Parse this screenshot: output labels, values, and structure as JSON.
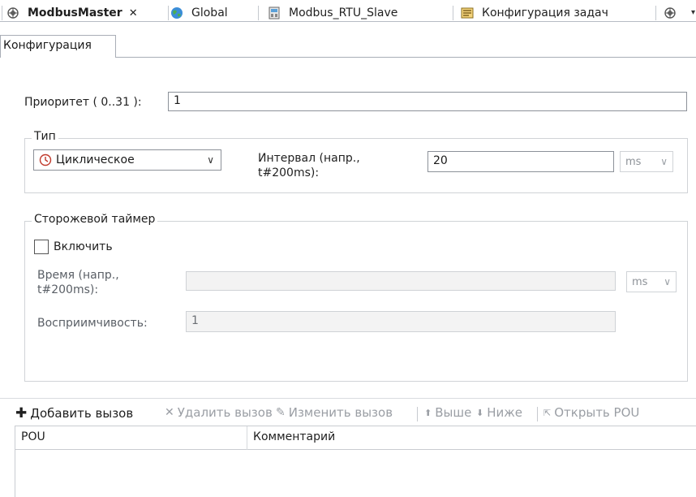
{
  "tabs": [
    {
      "label": "ModbusMaster",
      "active": true,
      "icon": "task-icon",
      "closable": true
    },
    {
      "label": "Global",
      "icon": "globe-icon"
    },
    {
      "label": "Modbus_RTU_Slave",
      "icon": "device-icon"
    },
    {
      "label": "Конфигурация задач",
      "icon": "task-config-icon"
    }
  ],
  "subtab": {
    "label": "Конфигурация"
  },
  "priority": {
    "label": "Приоритет ( 0..31 ):",
    "value": "1"
  },
  "type_group": {
    "title": "Тип",
    "selected": "Циклическое",
    "interval_label": "Интервал (напр., t#200ms):",
    "interval_value": "20",
    "interval_unit": "ms"
  },
  "watchdog": {
    "title": "Сторожевой таймер",
    "enable_label": "Включить",
    "enabled": false,
    "time_label": "Время (напр., t#200ms):",
    "time_value": "",
    "time_unit": "ms",
    "sensitivity_label": "Восприимчивость:",
    "sensitivity_value": "1"
  },
  "toolbar": {
    "add": "Добавить вызов",
    "remove": "Удалить вызов",
    "edit": "Изменить вызов",
    "up": "Выше",
    "down": "Ниже",
    "open": "Открыть POU"
  },
  "table": {
    "columns": [
      "POU",
      "Комментарий"
    ],
    "rows": []
  },
  "colors": {
    "add_icon": "#2f7d32",
    "disabled_text": "#9a9ea4",
    "border": "#8c9199"
  }
}
